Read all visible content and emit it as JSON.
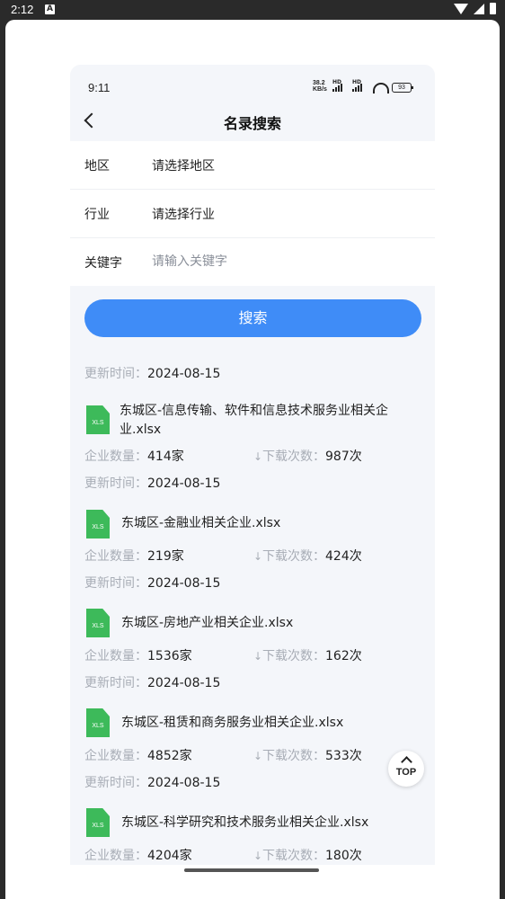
{
  "device_status": {
    "time": "2:12",
    "badge": "A"
  },
  "app_status": {
    "time": "9:11",
    "net_speed_top": "38.2",
    "net_speed_bottom": "KB/s",
    "hd": "HD",
    "battery": "93"
  },
  "nav": {
    "title": "名录搜索"
  },
  "form": {
    "region_label": "地区",
    "region_value": "请选择地区",
    "industry_label": "行业",
    "industry_value": "请选择行业",
    "keyword_label": "关键字",
    "keyword_placeholder": "请输入关键字"
  },
  "search_button": "搜索",
  "labels": {
    "count_label": "企业数量：",
    "downloads_label": "下载次数：",
    "updated_label": "更新时间：",
    "file_ext_icon": "XLS"
  },
  "partial_top": {
    "updated": "2024-08-15"
  },
  "files": [
    {
      "name": "东城区-信息传输、软件和信息技术服务业相关企业.xlsx",
      "count": "414家",
      "downloads": "987次",
      "updated": "2024-08-15"
    },
    {
      "name": "东城区-金融业相关企业.xlsx",
      "count": "219家",
      "downloads": "424次",
      "updated": "2024-08-15"
    },
    {
      "name": "东城区-房地产业相关企业.xlsx",
      "count": "1536家",
      "downloads": "162次",
      "updated": "2024-08-15"
    },
    {
      "name": "东城区-租赁和商务服务业相关企业.xlsx",
      "count": "4852家",
      "downloads": "533次",
      "updated": "2024-08-15"
    },
    {
      "name": "东城区-科学研究和技术服务业相关企业.xlsx",
      "count": "4204家",
      "downloads": "180次"
    }
  ],
  "top_button": "TOP"
}
